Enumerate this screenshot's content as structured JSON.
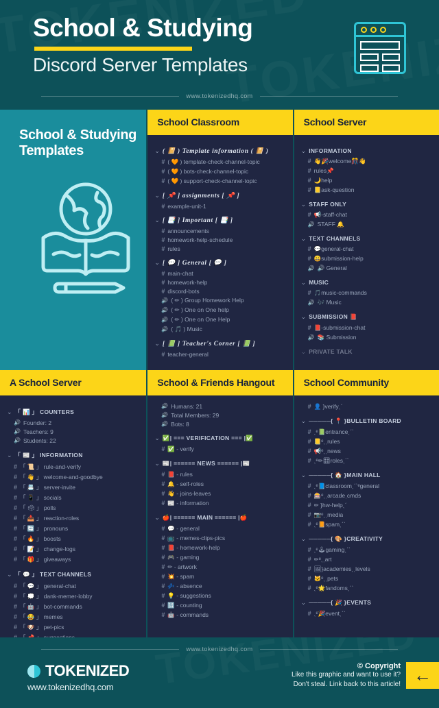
{
  "header": {
    "title": "School & Studying",
    "subtitle": "Discord Server Templates",
    "url": "www.tokenizedhq.com",
    "watermark": "TOKENIZED",
    "icon": "browser-window-icon"
  },
  "promo": {
    "title": "School & Studying Templates",
    "icon": "globe-book-pencil-icon"
  },
  "columns": [
    {
      "id": "school-classroom",
      "header": "School Classroom",
      "groups": [
        {
          "label": "( 📔 ) Template information ( 📔 )",
          "fancy": true,
          "channels": [
            {
              "type": "text",
              "name": "( 🧡 ) template-check-channel-topic"
            },
            {
              "type": "text",
              "name": "( 🧡 ) bots-check-channel-topic"
            },
            {
              "type": "text",
              "name": "( 🧡 ) support-check-channel-topic"
            }
          ]
        },
        {
          "label": "[ 📌 ] assignments [ 📌 ]",
          "fancy": true,
          "channels": [
            {
              "type": "text",
              "name": "example-unit-1"
            }
          ]
        },
        {
          "label": "[ 📑 ] Important [ 📑 ]",
          "fancy": true,
          "channels": [
            {
              "type": "text",
              "name": "announcements"
            },
            {
              "type": "text",
              "name": "homework-help-schedule"
            },
            {
              "type": "text",
              "name": "rules"
            }
          ]
        },
        {
          "label": "[ 💬 ] General [ 💬 ]",
          "fancy": true,
          "channels": [
            {
              "type": "text",
              "name": "main-chat"
            },
            {
              "type": "text",
              "name": "homework-help"
            },
            {
              "type": "text",
              "name": "discord-bots"
            },
            {
              "type": "voice",
              "name": "( ✏ ) Group Homework Help"
            },
            {
              "type": "voice",
              "name": "( ✏ ) One on One help"
            },
            {
              "type": "voice",
              "name": "( ✏ ) One on One Help"
            },
            {
              "type": "voice",
              "name": "( 🎵 ) Music"
            }
          ]
        },
        {
          "label": "[ 📗 ] Teacher's Corner [ 📗 ]",
          "fancy": true,
          "channels": [
            {
              "type": "text",
              "name": "teacher-general"
            }
          ]
        }
      ]
    },
    {
      "id": "school-server",
      "header": "School Server",
      "groups": [
        {
          "label": "INFORMATION",
          "fancy": false,
          "channels": [
            {
              "type": "text",
              "name": "👋🎉welcome🎊👋"
            },
            {
              "type": "text",
              "name": "rules📌"
            },
            {
              "type": "text",
              "name": "🌙help"
            },
            {
              "type": "text",
              "name": "📒ask-question"
            }
          ]
        },
        {
          "label": "STAFF ONLY",
          "fancy": false,
          "channels": [
            {
              "type": "text",
              "name": "📢-staff-chat"
            },
            {
              "type": "voice",
              "name": "STAFF 🔔"
            }
          ]
        },
        {
          "label": "TEXT CHANNELS",
          "fancy": false,
          "channels": [
            {
              "type": "text",
              "name": "💬general-chat"
            },
            {
              "type": "text",
              "name": "😀submission-help"
            },
            {
              "type": "voice",
              "name": "🔊 General"
            }
          ]
        },
        {
          "label": "MUSIC",
          "fancy": false,
          "channels": [
            {
              "type": "text",
              "name": "🎵music-commands"
            },
            {
              "type": "voice",
              "name": "🎶 Music"
            }
          ]
        },
        {
          "label": "SUBMISSION 📕",
          "fancy": false,
          "channels": [
            {
              "type": "text",
              "name": "📕-submission-chat"
            },
            {
              "type": "voice",
              "name": "📚 Submission"
            }
          ]
        },
        {
          "label": "PRIVATE TALK",
          "fancy": false,
          "cutoff": true,
          "channels": []
        }
      ]
    },
    {
      "id": "a-school-server",
      "header": "A School Server",
      "groups": [
        {
          "label": "「 📊 」 COUNTERS",
          "fancy": false,
          "channels": [
            {
              "type": "voice",
              "name": "Founder: 2"
            },
            {
              "type": "voice",
              "name": "Teachers: 9"
            },
            {
              "type": "voice",
              "name": "Students: 22"
            }
          ]
        },
        {
          "label": "「 📰 」 INFORMATION",
          "fancy": false,
          "channels": [
            {
              "type": "text",
              "name": "「 📜 」 rule-and-verify"
            },
            {
              "type": "text",
              "name": "「 👋 」 welcome-and-goodbye"
            },
            {
              "type": "text",
              "name": "「 📇 」 server-invite"
            },
            {
              "type": "text",
              "name": "「 📱 」 socials"
            },
            {
              "type": "text",
              "name": "「 🗳 」 polls"
            },
            {
              "type": "text",
              "name": "「 📥 」 reaction-roles"
            },
            {
              "type": "text",
              "name": "「 🔄 」 pronouns"
            },
            {
              "type": "text",
              "name": "「 🔥 」 boosts"
            },
            {
              "type": "text",
              "name": "「 📝 」 change-logs"
            },
            {
              "type": "text",
              "name": "「 🎁 」 giveaways"
            }
          ]
        },
        {
          "label": "「 💬 」 TEXT CHANNELS",
          "fancy": false,
          "channels": [
            {
              "type": "text",
              "name": "「 💬 」 general-chat"
            },
            {
              "type": "text",
              "name": "「 💭 」 dank-memer-lobby"
            },
            {
              "type": "text",
              "name": "「 🤖 」 bot-commands"
            },
            {
              "type": "text",
              "name": "「 😂 」 memes"
            },
            {
              "type": "text",
              "name": "「 🐶 」 pet-pics"
            },
            {
              "type": "text",
              "name": "「 📌 」 suggestions"
            }
          ]
        }
      ]
    },
    {
      "id": "school-friends-hangout",
      "header": "School & Friends Hangout",
      "groups": [
        {
          "label": "",
          "fancy": false,
          "nohead": true,
          "channels": [
            {
              "type": "voice",
              "name": "Humans: 21"
            },
            {
              "type": "voice",
              "name": "Total Members: 29"
            },
            {
              "type": "voice",
              "name": "Bots: 8"
            }
          ]
        },
        {
          "label": "✅| === VERIFICATION === |✅",
          "fancy": false,
          "channels": [
            {
              "type": "text",
              "name": "✅ - verify"
            }
          ]
        },
        {
          "label": "📰| ====== NEWS ====== |📰",
          "fancy": false,
          "channels": [
            {
              "type": "text",
              "name": "📕 - rules"
            },
            {
              "type": "text",
              "name": "🔔 - self-roles"
            },
            {
              "type": "text",
              "name": "👋 - joins-leaves"
            },
            {
              "type": "text",
              "name": "📰 - information"
            }
          ]
        },
        {
          "label": "🍎| ====== MAIN ====== |🍎",
          "fancy": false,
          "channels": [
            {
              "type": "text",
              "name": "💬 - general"
            },
            {
              "type": "text",
              "name": "📺 - memes-clips-pics"
            },
            {
              "type": "text",
              "name": "📕 - homework-help"
            },
            {
              "type": "text",
              "name": "🎮 - gaming"
            },
            {
              "type": "text",
              "name": "✏ - artwork"
            },
            {
              "type": "text",
              "name": "💥 - spam"
            },
            {
              "type": "text",
              "name": "💤 - absence"
            },
            {
              "type": "text",
              "name": "💡 - suggestions"
            },
            {
              "type": "text",
              "name": "🔢 - counting"
            },
            {
              "type": "text",
              "name": "🤖 - commands"
            }
          ]
        }
      ]
    },
    {
      "id": "school-community",
      "header": "School Community",
      "groups": [
        {
          "label": "",
          "fancy": false,
          "nohead": true,
          "channels": [
            {
              "type": "text",
              "name": "👤 }verifyˎˊ"
            }
          ]
        },
        {
          "label": "─────{ 📍 }BULLETIN BOARD",
          "fancy": false,
          "channels": [
            {
              "type": "text",
              "name": "ˎᵉ📗entranceˎˊˋ"
            },
            {
              "type": "text",
              "name": "📒ᵉˎˌrules"
            },
            {
              "type": "text",
              "name": "📢ᵉˎˌnews"
            },
            {
              "type": "text",
              "name": "ˎᵉ✏🎛rolesˎˊˋ"
            }
          ]
        },
        {
          "label": "─────{ 🏠 }MAIN HALL",
          "fancy": false,
          "channels": [
            {
              "type": "text",
              "name": "ˎᵉ📘classroomˎˊˋᵉgeneral"
            },
            {
              "type": "text",
              "name": "🎰ᵉˎˌarcadeˌcmds"
            },
            {
              "type": "text",
              "name": "✏ }hw-helpˎˊ"
            },
            {
              "type": "text",
              "name": "📷ᵉˎˌmedia"
            },
            {
              "type": "text",
              "name": "ˎᵉ📙spamˎˊˋ"
            }
          ]
        },
        {
          "label": "─────{ 🎨 }CREATIVITY",
          "fancy": false,
          "channels": [
            {
              "type": "text",
              "name": "ˎᵉ🕹gamingˎˊˋ"
            },
            {
              "type": "text",
              "name": "✏ᵉˎˌart"
            },
            {
              "type": "text",
              "name": "🖼}academiesˎˌlevels"
            },
            {
              "type": "text",
              "name": "🐱ᵉˎˌpets"
            },
            {
              "type": "text",
              "name": "ˎᵉ🌟fandomsˎˊˋ"
            }
          ]
        },
        {
          "label": "─────{ 🎉 }EVENTS",
          "fancy": false,
          "channels": [
            {
              "type": "text",
              "name": "ˎᵉ🎉eventˎˊˋ"
            }
          ]
        }
      ]
    }
  ],
  "footer": {
    "url": "www.tokenizedhq.com",
    "brand_name": "TOKENIZED",
    "brand_url": "www.tokenizedhq.com",
    "copyright_title": "© Copyright",
    "copyright_line1": "Like this graphic and want to use it?",
    "copyright_line2": "Don't steal. Link back to this article!",
    "arrow": "←"
  },
  "icons": {
    "text_channel": "#",
    "voice_channel": "🔊",
    "chevron": "⌄"
  },
  "colors": {
    "teal": "#0d5159",
    "teal_light": "#1a8d9c",
    "yellow": "#fcd518",
    "dark": "#202642",
    "cyan": "#2fc5d6"
  }
}
